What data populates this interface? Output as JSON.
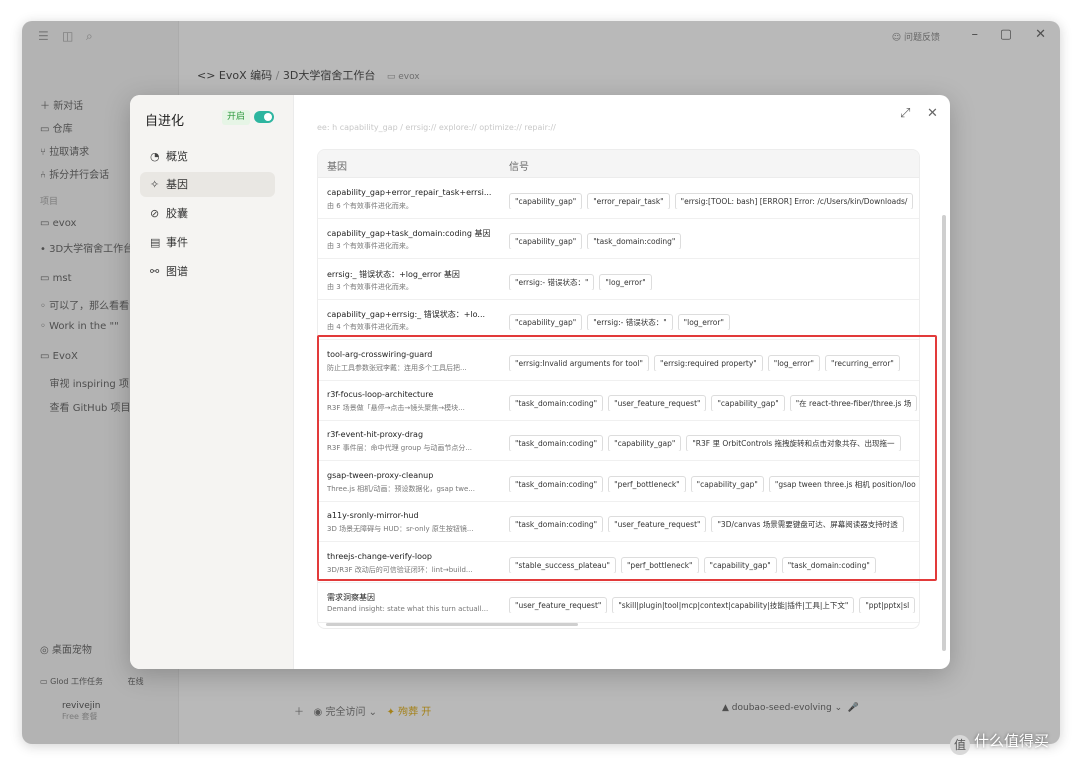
{
  "app": {
    "feedback": "问题反馈",
    "breadcrumb": {
      "project": "<> EvoX 编码",
      "sep": "/",
      "page": "3D大学宿舍工作台",
      "repo": "evox"
    },
    "sidebar": {
      "items": [
        "新对话",
        "仓库",
        "拉取请求",
        "拆分并行会话"
      ],
      "section": "项目",
      "group1": "evox",
      "active": "3D大学宿舍工作台",
      "group2": "mst",
      "sub1": "可以了，那么看看",
      "sub2": "Work in the \"\"",
      "group3": "EvoX",
      "sub3": "审视 inspiring 项",
      "sub4": "查看 GitHub 项目",
      "bottom1": "桌面宠物",
      "bottom2": "Glod 工作任务",
      "bottom2_badge": "在线"
    },
    "user": {
      "name": "revivejin",
      "plan": "Free 套餐"
    },
    "footer": {
      "access": "完全访问",
      "flame": "殉葬 开"
    },
    "model": "doubao-seed-evolving"
  },
  "modal": {
    "title": "自进化",
    "toggle_label": "开启",
    "nav": [
      {
        "icon": "gauge-icon",
        "glyph": "◔",
        "label": "概览"
      },
      {
        "icon": "gene-icon",
        "glyph": "✧",
        "label": "基因"
      },
      {
        "icon": "capsule-icon",
        "glyph": "⊘",
        "label": "胶囊"
      },
      {
        "icon": "events-icon",
        "glyph": "▤",
        "label": "事件"
      },
      {
        "icon": "graph-icon",
        "glyph": "⚯",
        "label": "图谱"
      }
    ],
    "filter_hint": "ee: h capability_gap / errsig:// explore:// optimize:// repair://",
    "table": {
      "col_gene": "基因",
      "col_signal": "信号",
      "rows": [
        {
          "name": "capability_gap+error_repair_task+errsi...",
          "desc": "由 6 个有效事件进化而来。",
          "signals": [
            "\"capability_gap\"",
            "\"error_repair_task\"",
            "\"errsig:[TOOL: bash] [ERROR] Error: /c/Users/kin/Downloads/"
          ]
        },
        {
          "name": "capability_gap+task_domain:coding 基因",
          "desc": "由 3 个有效事件进化而来。",
          "signals": [
            "\"capability_gap\"",
            "\"task_domain:coding\""
          ]
        },
        {
          "name": "errsig:_ 错误状态：+log_error 基因",
          "desc": "由 3 个有效事件进化而来。",
          "signals": [
            "\"errsig:- 错误状态：\"",
            "\"log_error\""
          ]
        },
        {
          "name": "capability_gap+errsig:_ 错误状态：+lo...",
          "desc": "由 4 个有效事件进化而来。",
          "signals": [
            "\"capability_gap\"",
            "\"errsig:- 错误状态：\"",
            "\"log_error\""
          ]
        },
        {
          "name": "tool-arg-crosswiring-guard",
          "desc": "防止工具参数张冠李戴：连用多个工具后把...",
          "signals": [
            "\"errsig:Invalid arguments for tool\"",
            "\"errsig:required property\"",
            "\"log_error\"",
            "\"recurring_error\""
          ]
        },
        {
          "name": "r3f-focus-loop-architecture",
          "desc": "R3F 场景做「悬停→点击→镜头聚焦→模块...",
          "signals": [
            "\"task_domain:coding\"",
            "\"user_feature_request\"",
            "\"capability_gap\"",
            "\"在 react-three-fiber/three.js 场"
          ]
        },
        {
          "name": "r3f-event-hit-proxy-drag",
          "desc": "R3F 事件层：命中代理 group 与动画节点分...",
          "signals": [
            "\"task_domain:coding\"",
            "\"capability_gap\"",
            "\"R3F 里 OrbitControls 拖拽旋转和点击对象共存、出现拖一"
          ]
        },
        {
          "name": "gsap-tween-proxy-cleanup",
          "desc": "Three.js 相机/动画：预设数据化，gsap twe...",
          "signals": [
            "\"task_domain:coding\"",
            "\"perf_bottleneck\"",
            "\"capability_gap\"",
            "\"gsap tween three.js 相机 position/loo"
          ]
        },
        {
          "name": "a11y-sronly-mirror-hud",
          "desc": "3D 场景无障碍与 HUD：sr-only 原生按钮镜...",
          "signals": [
            "\"task_domain:coding\"",
            "\"user_feature_request\"",
            "\"3D/canvas 场景需要键盘可达、屏幕阅读器支持时透"
          ]
        },
        {
          "name": "threejs-change-verify-loop",
          "desc": "3D/R3F 改动后的可信验证闭环：lint→build...",
          "signals": [
            "\"stable_success_plateau\"",
            "\"perf_bottleneck\"",
            "\"capability_gap\"",
            "\"task_domain:coding\""
          ]
        },
        {
          "name": "需求洞察基因",
          "desc": "Demand insight: state what this turn actuall...",
          "signals": [
            "\"user_feature_request\"",
            "\"skill|plugin|tool|mcp|context|capability|技能|插件|工具|上下文\"",
            "\"ppt|pptx|sl"
          ]
        }
      ]
    }
  },
  "watermark": "什么值得买",
  "colors": {
    "toggle": "#2eb5a0",
    "highlight_box": "#e23a3a",
    "toggle_label": "#2f9a3f"
  }
}
